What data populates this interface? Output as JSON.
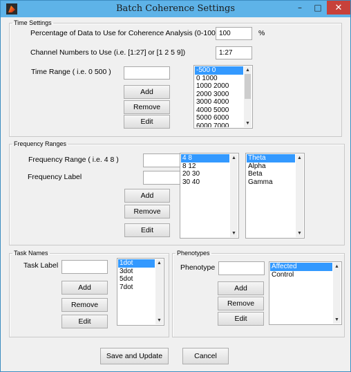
{
  "window": {
    "title": "Batch Coherence Settings",
    "minimize": "–",
    "maximize": "□",
    "close": "✕"
  },
  "time_settings": {
    "legend": "Time Settings",
    "percentage_label": "Percentage of Data to Use for Coherence Analysis (0-100)",
    "percentage_value": "100",
    "percentage_unit": "%",
    "channels_label": "Channel Numbers to Use (i.e. [1:27] or [1 2 5 9])",
    "channels_value": "1:27",
    "time_range_label": "Time Range ( i.e.  0 500 )",
    "time_range_value": "",
    "add": "Add",
    "remove": "Remove",
    "edit": "Edit",
    "list": [
      "-500 0",
      "0 1000",
      "1000 2000",
      "2000 3000",
      "3000 4000",
      "4000 5000",
      "5000 6000",
      "6000 7000"
    ],
    "selected_index": 0,
    "scroll_fraction": 0.55
  },
  "frequency_ranges": {
    "legend": "Frequency Ranges",
    "range_label": "Frequency Range ( i.e.  4 8 )",
    "range_value": "",
    "freq_label_label": "Frequency Label",
    "freq_label_value": "",
    "add": "Add",
    "remove": "Remove",
    "edit": "Edit",
    "ranges": [
      "4 8",
      "8 12",
      "20 30",
      "30 40"
    ],
    "ranges_selected": 0,
    "labels": [
      "Theta",
      "Alpha",
      "Beta",
      "Gamma"
    ],
    "labels_selected": 0
  },
  "task_names": {
    "legend": "Task Names",
    "task_label": "Task Label",
    "task_value": "",
    "add": "Add",
    "remove": "Remove",
    "edit": "Edit",
    "list": [
      "1dot",
      "3dot",
      "5dot",
      "7dot"
    ],
    "selected_index": 0
  },
  "phenotypes": {
    "legend": "Phenotypes",
    "phenotype_label": "Phenotype",
    "phenotype_value": "",
    "add": "Add",
    "remove": "Remove",
    "edit": "Edit",
    "list": [
      "Affected",
      "Control"
    ],
    "selected_index": 0
  },
  "footer": {
    "save": "Save and Update",
    "cancel": "Cancel"
  },
  "icons": {
    "up": "▲",
    "down": "▼"
  }
}
